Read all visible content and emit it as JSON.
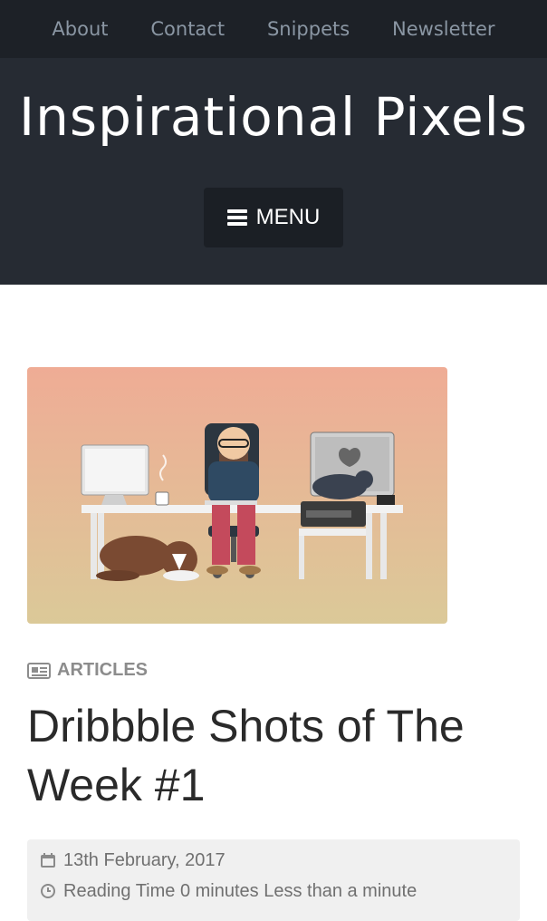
{
  "nav": {
    "items": [
      "About",
      "Contact",
      "Snippets",
      "Newsletter"
    ]
  },
  "site": {
    "title": "Inspirational Pixels",
    "menu_label": "MENU"
  },
  "post": {
    "category": "ARTICLES",
    "title": "Dribbble Shots of The Week #1",
    "date": "13th February, 2017",
    "reading_time": "Reading Time 0 minutes Less than a minute"
  },
  "colors": {
    "nav_bg": "#1d2127",
    "hero_bg": "#262b33",
    "menu_bg": "#1b1f25"
  },
  "icons": {
    "menu": "hamburger-icon",
    "category": "newspaper-icon",
    "date": "calendar-icon",
    "time": "clock-icon"
  }
}
